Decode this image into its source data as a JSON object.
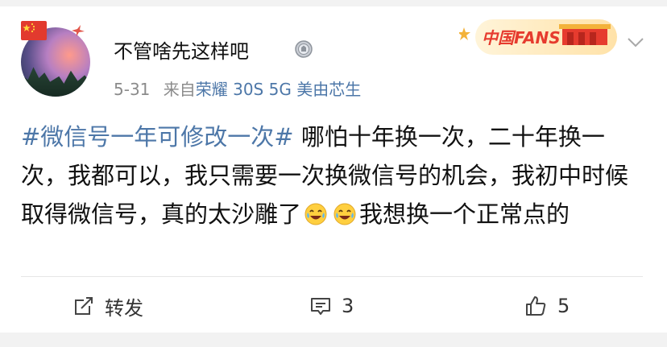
{
  "post": {
    "username": "不管啥先这样吧",
    "date": "5-31",
    "source_prefix": "来自",
    "device": "荣耀 30S 5G 美由芯生",
    "topic": "#微信号一年可修改一次#",
    "text_part1": " 哪怕十年换一次，二十年换一次，我都可以，我只需要一次换微信号的机会，我初中时候取得微信号，真的太沙雕了",
    "text_part2": "我想换一个正常点的"
  },
  "badge": {
    "label": "中国FANS"
  },
  "actions": {
    "repost_label": "转发",
    "comment_count": "3",
    "like_count": "5"
  },
  "colors": {
    "link": "#4d77a8",
    "meta": "#8b8b8b",
    "badge_red": "#e63b2e",
    "badge_gold": "#f3b23a"
  }
}
